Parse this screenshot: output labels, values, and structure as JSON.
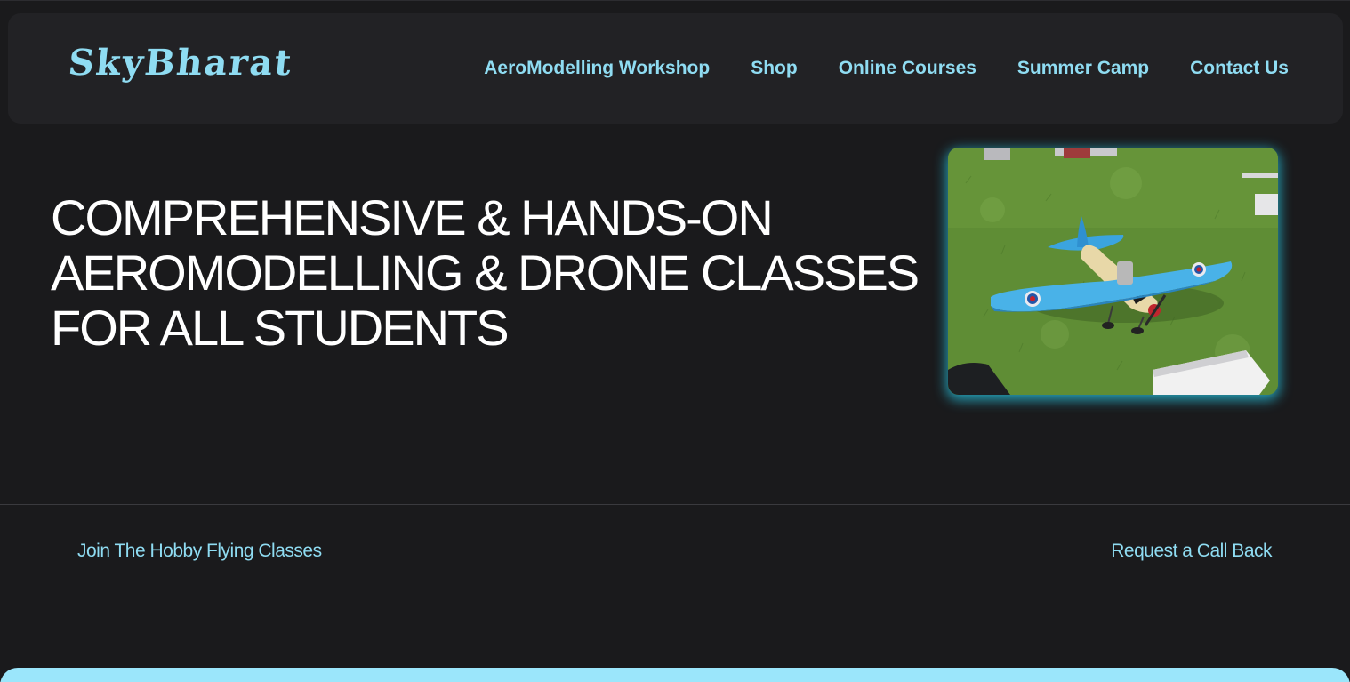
{
  "brand": {
    "logo_text": "SkyBharat",
    "accent_color": "#8fdcf2"
  },
  "nav": {
    "items": [
      {
        "label": "AeroModelling Workshop"
      },
      {
        "label": "Shop"
      },
      {
        "label": "Online Courses"
      },
      {
        "label": "Summer Camp"
      },
      {
        "label": "Contact Us"
      }
    ]
  },
  "hero": {
    "title": "COMPREHENSIVE & HANDS-ON AEROMODELLING & DRONE CLASSES FOR ALL STUDENTS",
    "image_subject": "rc-model-airplane-on-grass"
  },
  "cta": {
    "join_label": "Join The Hobby Flying Classes",
    "callback_label": "Request a Call Back"
  },
  "colors": {
    "background": "#1a1a1c",
    "navbar": "#222225",
    "bottom_band": "#9be6fb"
  }
}
